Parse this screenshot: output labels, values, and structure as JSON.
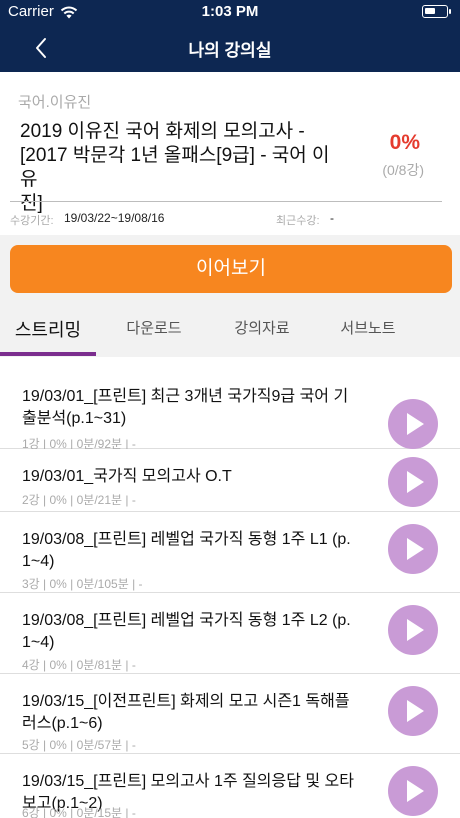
{
  "status_bar": {
    "carrier": "Carrier",
    "time": "1:03 PM"
  },
  "nav": {
    "title": "나의 강의실",
    "back_icon": "chevron-left-icon"
  },
  "course": {
    "subtitle": "국어.이유진",
    "title_line1": "2019 이유진 국어 화제의 모의고사 -",
    "title_line2": "[2017 박문각 1년 올패스[9급] - 국어 이유",
    "title_line3": "진]",
    "progress_percent": "0%",
    "progress_count": "(0/8강)",
    "period_label": "수강기간:",
    "period_value": "19/03/22~19/08/16",
    "recent_label": "최근수강:",
    "recent_value": "-"
  },
  "continue_button": "이어보기",
  "tabs": [
    {
      "label": "스트리밍",
      "active": true
    },
    {
      "label": "다운로드",
      "active": false
    },
    {
      "label": "강의자료",
      "active": false
    },
    {
      "label": "서브노트",
      "active": false
    }
  ],
  "lectures": [
    {
      "title_line1": "19/03/01_[프린트] 최근 3개년 국가직9급 국어 기",
      "title_line2": "출분석(p.1~31)",
      "meta": "1강 | 0% | 0분/92분 | -"
    },
    {
      "title_line1": "19/03/01_국가직 모의고사 O.T",
      "title_line2": "",
      "meta": "2강 | 0% | 0분/21분 | -"
    },
    {
      "title_line1": "19/03/08_[프린트] 레벨업 국가직 동형 1주 L1 (p.",
      "title_line2": "1~4)",
      "meta": "3강 | 0% | 0분/105분 | -"
    },
    {
      "title_line1": "19/03/08_[프린트] 레벨업 국가직 동형 1주 L2 (p.",
      "title_line2": "1~4)",
      "meta": "4강 | 0% | 0분/81분 | -"
    },
    {
      "title_line1": "19/03/15_[이전프린트] 화제의 모고 시즌1 독해플",
      "title_line2": "러스(p.1~6)",
      "meta": "5강 | 0% | 0분/57분 | -"
    },
    {
      "title_line1": "19/03/15_[프린트] 모의고사 1주 질의응답 및 오타",
      "title_line2": "보고(p.1~2)",
      "meta": "6강 | 0% | 0분/15분 | -"
    }
  ],
  "colors": {
    "header_bg": "#0d2752",
    "accent_orange": "#f7861f",
    "progress_red": "#e53b2e",
    "tab_indicator": "#7b2d8e",
    "play_button": "#c99bd6"
  }
}
